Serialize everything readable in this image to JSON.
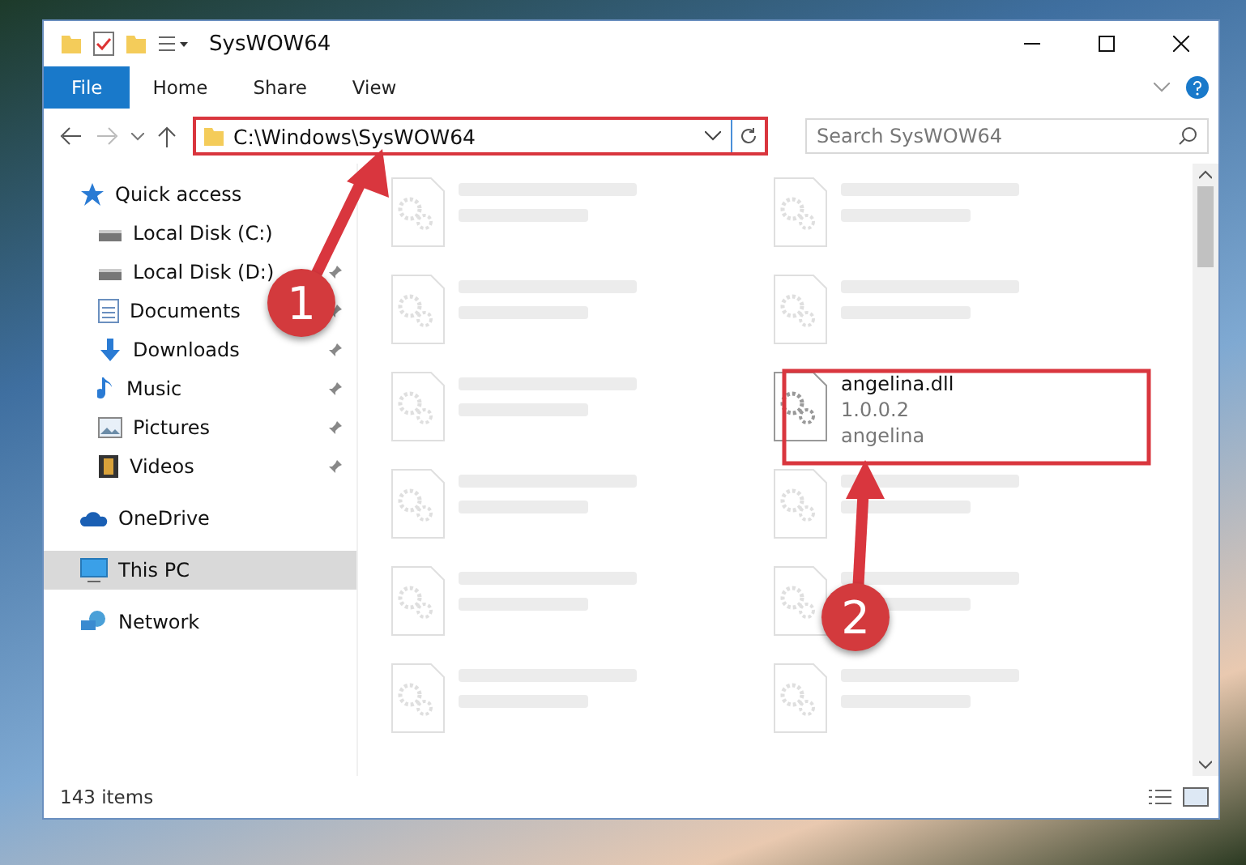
{
  "window": {
    "title": "SysWOW64"
  },
  "ribbon": {
    "tabs": [
      {
        "label": "File",
        "selected": true
      },
      {
        "label": "Home",
        "selected": false
      },
      {
        "label": "Share",
        "selected": false
      },
      {
        "label": "View",
        "selected": false
      }
    ]
  },
  "address": {
    "path": "C:\\Windows\\SysWOW64",
    "search_placeholder": "Search SysWOW64"
  },
  "sidebar": {
    "items": [
      {
        "label": "Quick access",
        "selected": false,
        "children": [
          {
            "label": "Local Disk (C:)",
            "pinned": false,
            "selected": false
          },
          {
            "label": "Local Disk (D:)",
            "pinned": true,
            "selected": false
          },
          {
            "label": "Documents",
            "pinned": true,
            "selected": false
          },
          {
            "label": "Downloads",
            "pinned": true,
            "selected": false
          },
          {
            "label": "Music",
            "pinned": true,
            "selected": false
          },
          {
            "label": "Pictures",
            "pinned": true,
            "selected": false
          },
          {
            "label": "Videos",
            "pinned": true,
            "selected": false
          }
        ]
      },
      {
        "label": "OneDrive",
        "selected": false
      },
      {
        "label": "This PC",
        "selected": true
      },
      {
        "label": "Network",
        "selected": false
      }
    ]
  },
  "files": {
    "columns": [
      [
        {
          "kind": "blurred"
        },
        {
          "kind": "blurred"
        },
        {
          "kind": "blurred"
        },
        {
          "kind": "blurred"
        },
        {
          "kind": "blurred"
        },
        {
          "kind": "blurred"
        }
      ],
      [
        {
          "kind": "blurred"
        },
        {
          "kind": "blurred"
        },
        {
          "kind": "file",
          "name": "angelina.dll",
          "version": "1.0.0.2",
          "company": "angelina"
        },
        {
          "kind": "blurred"
        },
        {
          "kind": "blurred"
        },
        {
          "kind": "blurred"
        }
      ]
    ]
  },
  "status_bar": {
    "count": "143 items"
  },
  "annotations": [
    {
      "number": "1"
    },
    {
      "number": "2"
    }
  ]
}
